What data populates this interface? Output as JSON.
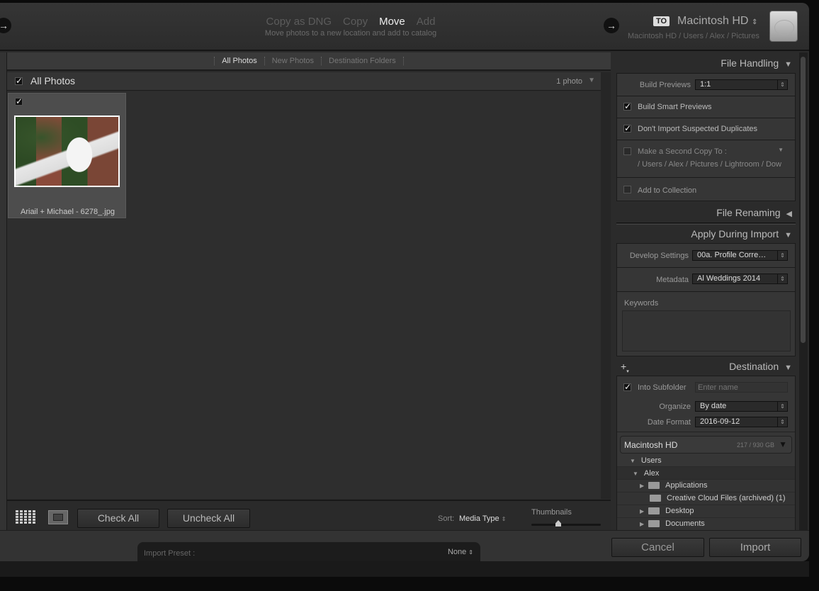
{
  "header": {
    "modes": [
      {
        "label": "Copy as DNG",
        "active": false
      },
      {
        "label": "Copy",
        "active": false
      },
      {
        "label": "Move",
        "active": true
      },
      {
        "label": "Add",
        "active": false
      }
    ],
    "mode_description": "Move photos to a new location and add to catalog",
    "to_badge": "TO",
    "destination_volume": "Macintosh HD",
    "destination_path": "Macintosh HD / Users / Alex / Pictures"
  },
  "view_tabs": [
    "All Photos",
    "New Photos",
    "Destination Folders"
  ],
  "grid": {
    "title": "All Photos",
    "count": "1 photo",
    "photos": [
      {
        "filename": "Ariail + Michael - 6278_.jpg",
        "checked": true
      }
    ]
  },
  "toolbar": {
    "check_all": "Check All",
    "uncheck_all": "Uncheck All",
    "sort_label": "Sort:",
    "sort_value": "Media Type",
    "thumbnails_label": "Thumbnails",
    "thumbnail_size": 0.2
  },
  "file_handling": {
    "title": "File Handling",
    "build_previews_label": "Build Previews",
    "build_previews_value": "1:1",
    "smart_previews": "Build Smart Previews",
    "no_duplicates": "Don't Import Suspected Duplicates",
    "second_copy": "Make a Second Copy To :",
    "second_copy_path": "/ Users / Alex / Pictures / Lightroom / Dow",
    "add_collection": "Add to Collection"
  },
  "file_renaming": {
    "title": "File Renaming"
  },
  "apply_during_import": {
    "title": "Apply During Import",
    "develop_label": "Develop Settings",
    "develop_value": "00a. Profile Corre…",
    "metadata_label": "Metadata",
    "metadata_value": "Al Weddings 2014",
    "keywords_label": "Keywords"
  },
  "destination": {
    "title": "Destination",
    "into_subfolder": "Into Subfolder",
    "subfolder_placeholder": "Enter name",
    "organize_label": "Organize",
    "organize_value": "By date",
    "date_format_label": "Date Format",
    "date_format_value": "2016-09-12",
    "volume": "Macintosh HD",
    "volume_space": "217 / 930 GB",
    "tree": [
      "Users",
      "Alex",
      "Applications",
      "Creative Cloud Files (archived) (1)",
      "Desktop",
      "Documents"
    ]
  },
  "footer": {
    "preset_label": "Import Preset :",
    "preset_value": "None",
    "cancel": "Cancel",
    "import": "Import"
  }
}
